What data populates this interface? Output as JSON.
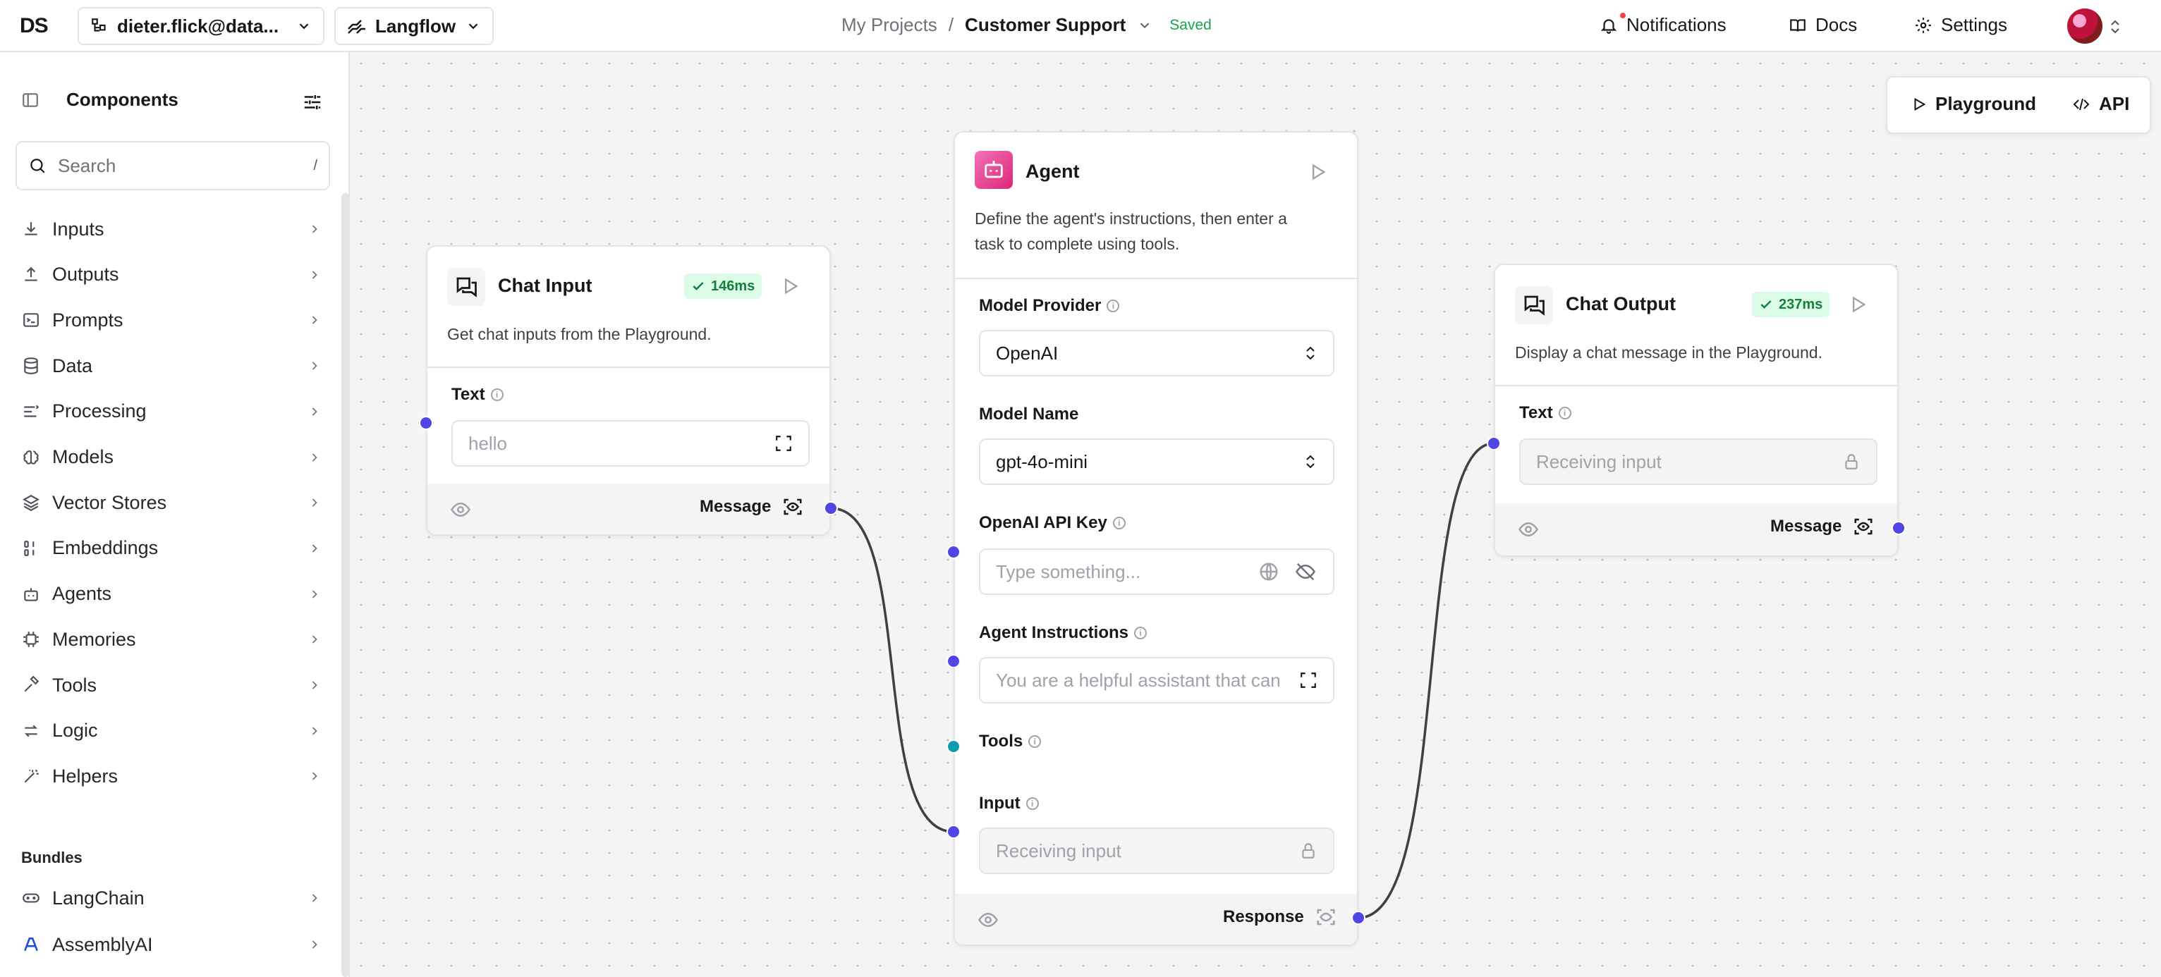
{
  "header": {
    "logo": "DS",
    "org": "dieter.flick@data...",
    "app": "Langflow",
    "breadcrumb_root": "My Projects",
    "breadcrumb_sep": "/",
    "project": "Customer Support",
    "status": "Saved",
    "notifications": "Notifications",
    "docs": "Docs",
    "settings": "Settings"
  },
  "sidebar": {
    "title": "Components",
    "search_placeholder": "Search",
    "search_shortcut": "/",
    "items": [
      {
        "label": "Inputs",
        "icon": "download-icon"
      },
      {
        "label": "Outputs",
        "icon": "upload-icon"
      },
      {
        "label": "Prompts",
        "icon": "prompt-icon"
      },
      {
        "label": "Data",
        "icon": "database-icon"
      },
      {
        "label": "Processing",
        "icon": "processing-icon"
      },
      {
        "label": "Models",
        "icon": "brain-icon"
      },
      {
        "label": "Vector Stores",
        "icon": "layers-icon"
      },
      {
        "label": "Embeddings",
        "icon": "binary-icon"
      },
      {
        "label": "Agents",
        "icon": "bot-icon"
      },
      {
        "label": "Memories",
        "icon": "cpu-icon"
      },
      {
        "label": "Tools",
        "icon": "hammer-icon"
      },
      {
        "label": "Logic",
        "icon": "arrows-icon"
      },
      {
        "label": "Helpers",
        "icon": "wand-icon"
      }
    ],
    "bundles_label": "Bundles",
    "bundles": [
      {
        "label": "LangChain",
        "icon": "langchain-icon"
      },
      {
        "label": "AssemblyAI",
        "icon": "assemblyai-icon"
      }
    ]
  },
  "canvas_toolbar": {
    "playground": "Playground",
    "api": "API"
  },
  "nodes": {
    "chat_input": {
      "title": "Chat Input",
      "badge": "146ms",
      "description": "Get chat inputs from the Playground.",
      "field_label": "Text",
      "field_value": "hello",
      "output_label": "Message"
    },
    "agent": {
      "title": "Agent",
      "description_line1": "Define the agent's instructions, then enter a",
      "description_line2": "task to complete using tools.",
      "model_provider_label": "Model Provider",
      "model_provider_value": "OpenAI",
      "model_name_label": "Model Name",
      "model_name_value": "gpt-4o-mini",
      "api_key_label": "OpenAI API Key",
      "api_key_placeholder": "Type something...",
      "instructions_label": "Agent Instructions",
      "instructions_value": "You are a helpful assistant that can",
      "tools_label": "Tools",
      "input_label": "Input",
      "input_value": "Receiving input",
      "output_label": "Response"
    },
    "chat_output": {
      "title": "Chat Output",
      "badge": "237ms",
      "description": "Display a chat message in the Playground.",
      "field_label": "Text",
      "field_value": "Receiving input",
      "output_label": "Message"
    }
  },
  "colors": {
    "handle_message": "#4f46e5",
    "handle_tools": "#0e9bb0",
    "success_badge_bg": "#dcfce7",
    "success_badge_text": "#15803d",
    "agent_icon_bg": "#db2777"
  }
}
